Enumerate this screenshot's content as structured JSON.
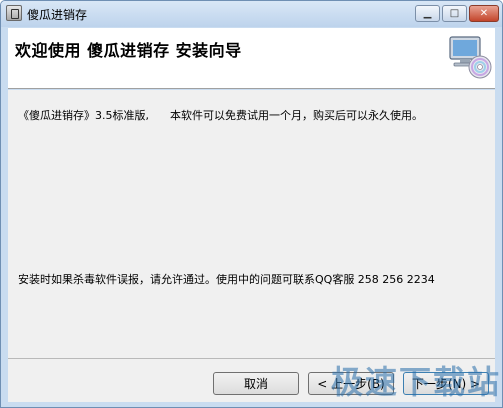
{
  "window": {
    "title": "傻瓜进销存"
  },
  "header": {
    "title": "欢迎使用  傻瓜进销存  安装向导"
  },
  "content": {
    "line1": "《傻瓜进销存》3.5标准版,      本软件可以免费试用一个月，购买后可以永久使用。",
    "line2": "安装时如果杀毒软件误报，请允许通过。使用中的问题可联系QQ客服 258 256 2234"
  },
  "buttons": {
    "cancel": "取消",
    "prev": "< 上一步(B)",
    "next": "下一步(N) >"
  },
  "watermark": "极速下载站",
  "colors": {
    "title_bar": "#c9dcf0",
    "content_bg": "#f0f0f0",
    "watermark": "#286eaa"
  },
  "icons": {
    "app": "app-icon",
    "header": "computer-cd-icon",
    "minimize": "minimize-icon",
    "maximize": "maximize-icon",
    "close": "close-icon"
  }
}
